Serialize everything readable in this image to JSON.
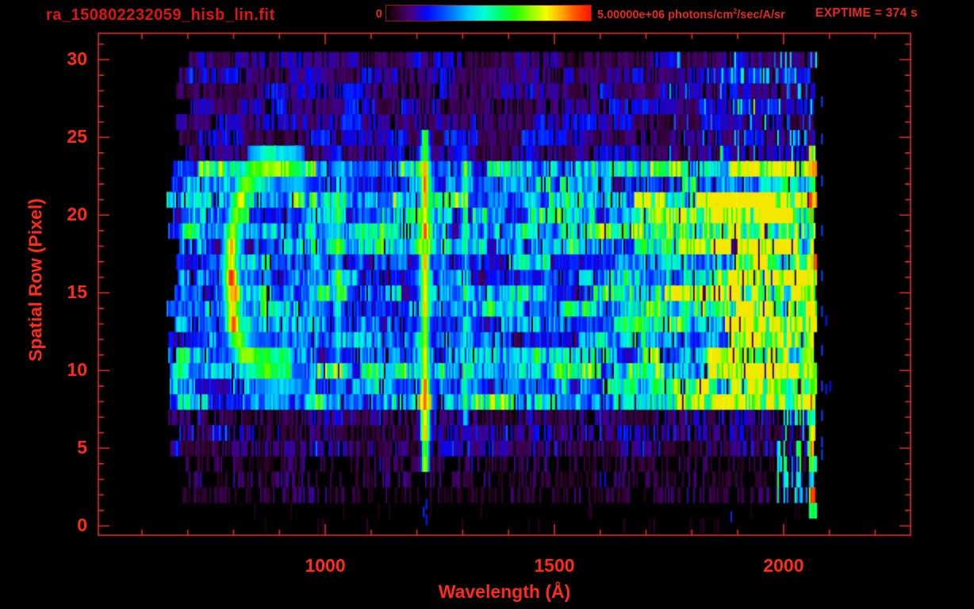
{
  "header": {
    "title": "ra_150802232059_hisb_lin.fit",
    "exptime": "EXPTIME = 374 s",
    "colorbar": {
      "min_label": "0",
      "max_label_prefix": "5.00000e+06 photons/cm",
      "max_label_sup": "2",
      "max_label_suffix": "/sec/A/sr"
    }
  },
  "chart_data": {
    "type": "heatmap",
    "title": "ra_150802232059_hisb_lin.fit",
    "xlabel": "Wavelength (Å)",
    "ylabel": "Spatial Row (Pixel)",
    "xlim": [
      505,
      2277
    ],
    "ylim": [
      -0.6,
      31.7
    ],
    "x_major_ticks": [
      1000,
      1500,
      2000
    ],
    "x_minor_step": 100,
    "y_major_ticks": [
      0,
      5,
      10,
      15,
      20,
      25,
      30
    ],
    "y_minor_step": 1,
    "colorbar_range_photons": [
      0,
      5000000
    ],
    "colorbar_units": "photons/cm²/sec/A/sr",
    "exposure_time_s": 374,
    "colors": {
      "title_red": "#e01511",
      "label_red": "#ff2b17",
      "frame_red": "#e6301f",
      "colorbar_border": "#8d1d12",
      "background": "#000000"
    },
    "colormap_stops": [
      [
        0.0,
        "#000000"
      ],
      [
        0.05,
        "#30002a"
      ],
      [
        0.12,
        "#460080"
      ],
      [
        0.2,
        "#0008ff"
      ],
      [
        0.3,
        "#0060ff"
      ],
      [
        0.4,
        "#00ccff"
      ],
      [
        0.48,
        "#00ffd0"
      ],
      [
        0.56,
        "#00ff60"
      ],
      [
        0.63,
        "#20ff00"
      ],
      [
        0.72,
        "#a0ff00"
      ],
      [
        0.78,
        "#f0ff00"
      ],
      [
        0.85,
        "#ffb000"
      ],
      [
        0.92,
        "#ff5800"
      ],
      [
        1.0,
        "#ff1000"
      ]
    ],
    "texture": {
      "noise_seed": 7,
      "wavelength_extent": [
        648,
        2068
      ],
      "row_extent": [
        0,
        30
      ],
      "signal_band_rows": [
        8,
        23
      ],
      "column_step_angstrom": 3.46,
      "row_gains": [
        0.5,
        0.5,
        0.8,
        1.0,
        0.9,
        1.0,
        1.1,
        1.0,
        1.2,
        0.95,
        1.25,
        1.0,
        0.8,
        0.9,
        1.05,
        1.15,
        0.85,
        0.9,
        1.0,
        1.2,
        1.1,
        1.3,
        1.0,
        1.25,
        0.9,
        1.0,
        0.95,
        1.05,
        0.9,
        1.0,
        0.9
      ],
      "band_base": 0.3,
      "upper_rows_base": 0.13,
      "lower_rows_base": 0.1,
      "sparse_rows_base": 0.08,
      "continuum_ramp": {
        "start_low_rows": 1700,
        "start_mid_rows": 1640,
        "start_top_rows": 1620,
        "start_edge_rows": 1880,
        "length": 260,
        "amplitude": 0.3
      },
      "emission_lines": [
        {
          "wavelength": 975,
          "sigma": 9,
          "amp": 0.06,
          "row_min": 8,
          "row_max": 23
        },
        {
          "wavelength": 1025,
          "sigma": 9,
          "amp": 0.18,
          "row_min": 7.5,
          "row_max": 23.5,
          "hot_rows": [
            19,
            22
          ],
          "hot_factor": 1.3
        },
        {
          "wavelength": 1216,
          "sigma": 10,
          "amp": 0.52,
          "row_min": 4.8,
          "row_max": 24.2,
          "hot_rows": [
            7,
            10.5
          ],
          "hot_factor": 1.18,
          "hot_rows2": [
            19,
            23
          ],
          "blob_prob": 0.35,
          "blob_add": 0.12
        },
        {
          "wavelength": 1303,
          "sigma": 7,
          "amp": 0.22,
          "row_min": 6,
          "row_max": 24,
          "hot_rows": [
            18,
            22
          ],
          "hot_factor": 1.35
        }
      ],
      "crescent": {
        "path": [
          [
            940,
            22.9
          ],
          [
            903,
            23.2
          ],
          [
            862,
            23.1
          ],
          [
            828,
            22.3
          ],
          [
            807,
            20.6
          ],
          [
            796,
            18.6
          ],
          [
            792,
            16.5
          ],
          [
            794,
            14.4
          ],
          [
            802,
            12.6
          ],
          [
            818,
            11.3
          ],
          [
            845,
            10.6
          ],
          [
            880,
            10.4
          ],
          [
            918,
            10.7
          ]
        ],
        "amp_arc": 0.44,
        "amp_bar": 0.52,
        "amp_fade": 0.34,
        "bar_rows": [
          12.2,
          18.6
        ],
        "bar_max_wavelength": 815,
        "fade_wavelength": 885,
        "sigma_wavelength": 15,
        "sigma_row": 1.05,
        "hotspots": [
          [
            794,
            16.2,
            0.3
          ],
          [
            798,
            13.3,
            0.32
          ],
          [
            803,
            14.8,
            0.16
          ],
          [
            794,
            17.7,
            0.2
          ]
        ],
        "tail": {
          "path": [
            [
              836,
              10.1
            ],
            [
              868,
              9.5
            ],
            [
              904,
              9.2
            ],
            [
              944,
              9.4
            ]
          ],
          "amp": 0.15,
          "sigma_row": 0.8
        }
      },
      "edge_column": {
        "wavelength_min": 2052,
        "row_min": 1,
        "row_max": 24,
        "forced": {
          "2": 0.92,
          "8": 0.88,
          "9": 0.8,
          "1": 0.55
        }
      },
      "right_low_dashes": {
        "rows": [
          2,
          7
        ],
        "wavelengths": [
          1985,
          2052
        ],
        "prob": 0.3
      },
      "stray_marks": [
        {
          "wavelength": 1213,
          "rows": [
            0.9
          ],
          "v": 0.24
        },
        {
          "wavelength": 1219,
          "rows": [
            0.4,
            1.4
          ],
          "v": 0.22
        },
        {
          "wavelength": 1884,
          "rows": [
            0.6
          ],
          "v": 0.24
        },
        {
          "wavelength": 2082,
          "rows": [
            4.6,
            5.4,
            7.1,
            9.0,
            11.3,
            13.8,
            16.1,
            19.0,
            22.2,
            24.9,
            27.3
          ],
          "v": 0.26
        },
        {
          "wavelength": 2091,
          "rows": [
            8.8,
            13.2
          ],
          "v": 0.22
        },
        {
          "wavelength": 2100,
          "rows": [
            9.0
          ],
          "v": 0.2
        }
      ]
    }
  }
}
